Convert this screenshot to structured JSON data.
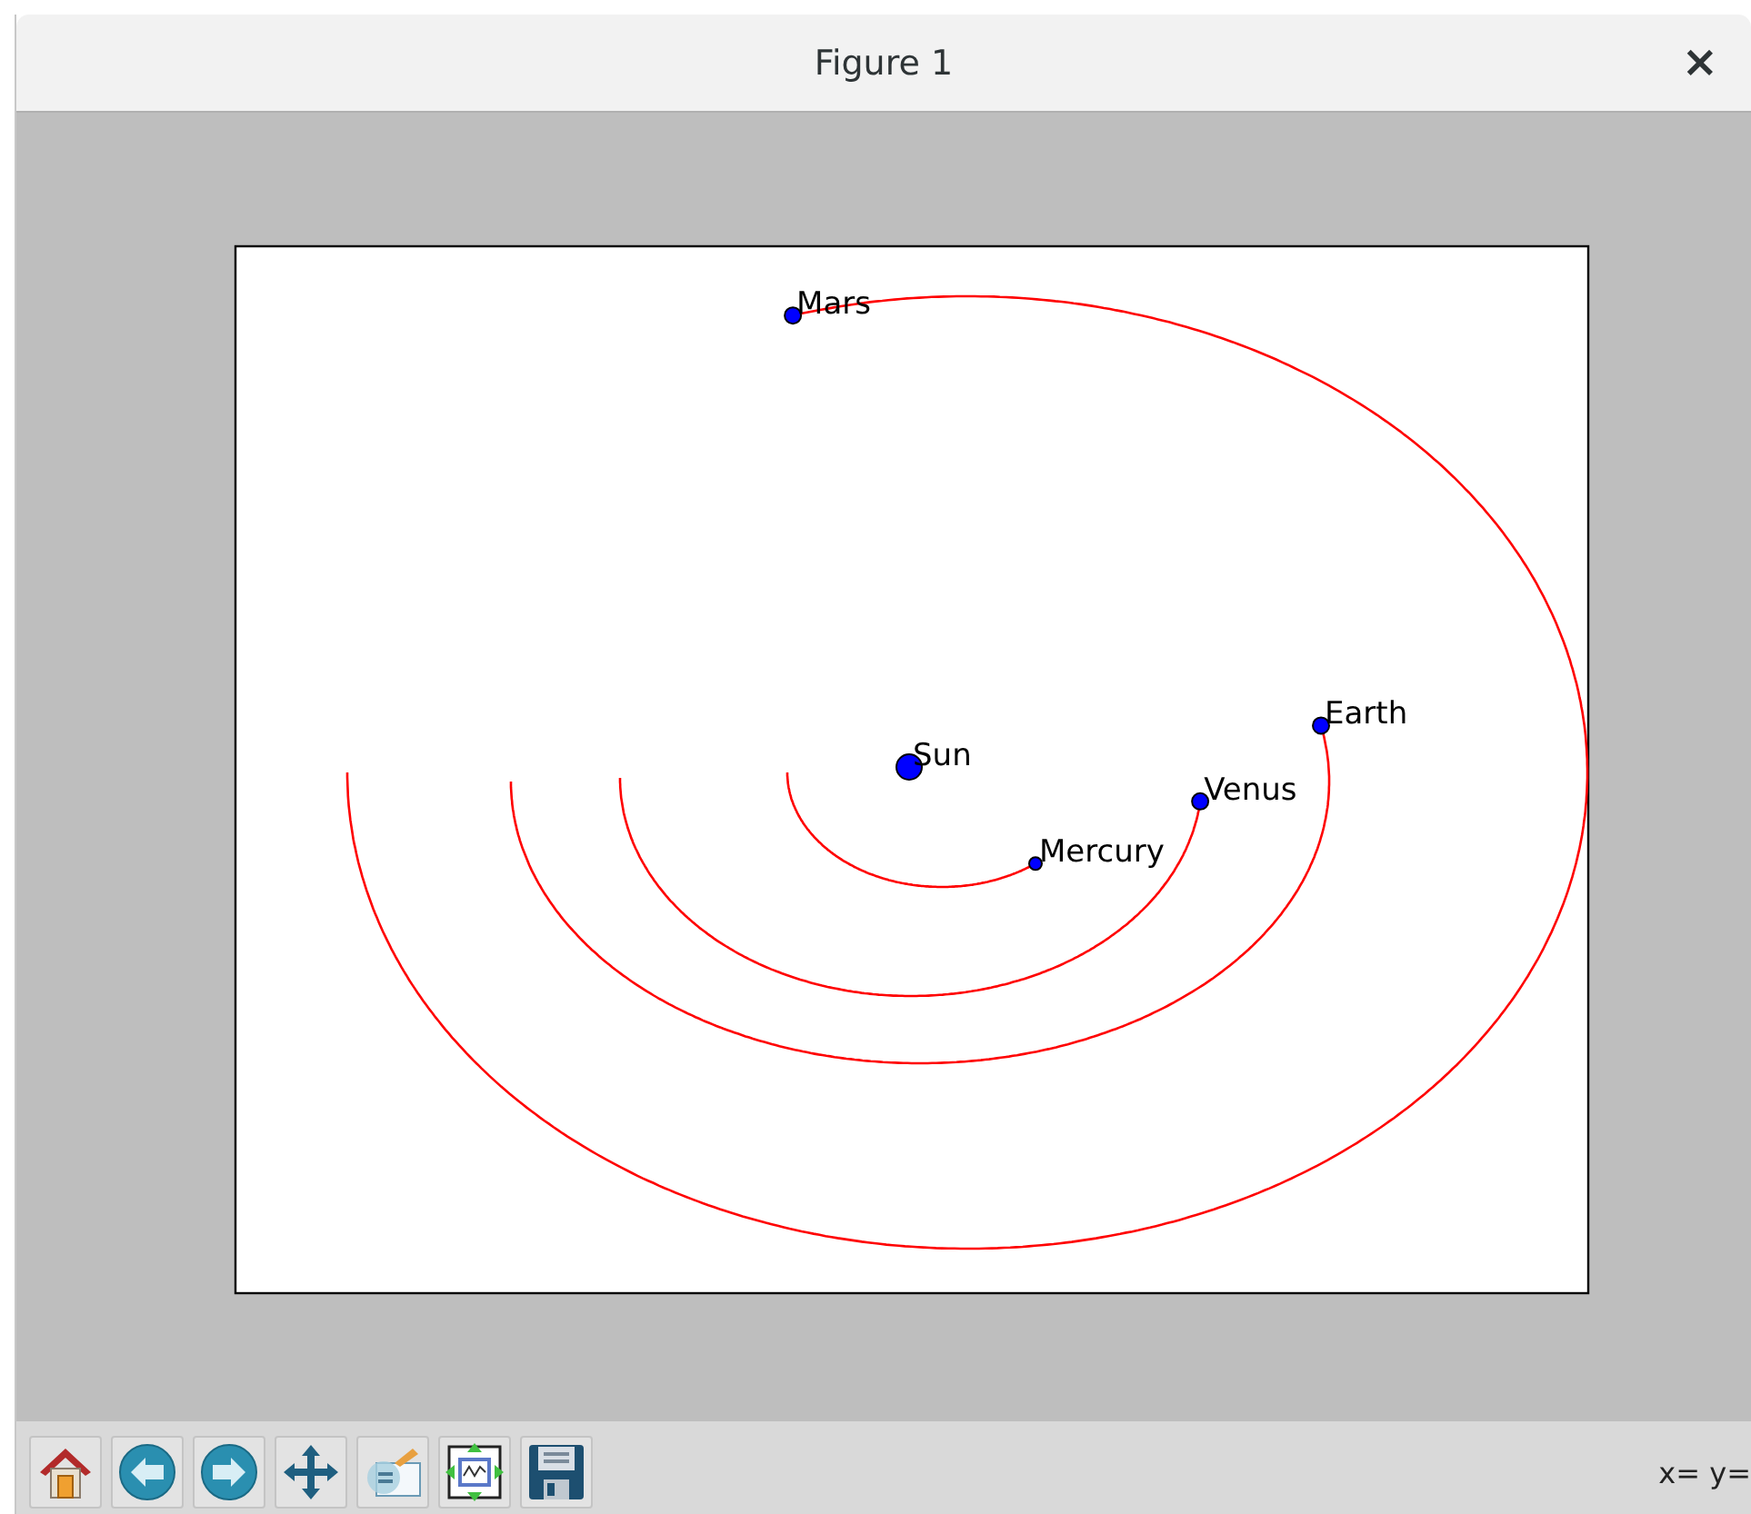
{
  "window": {
    "title": "Figure 1",
    "close": "×"
  },
  "plot": {
    "bodies": [
      {
        "name": "Mars",
        "kind": "planet"
      },
      {
        "name": "Earth",
        "kind": "planet"
      },
      {
        "name": "Sun",
        "kind": "star"
      },
      {
        "name": "Venus",
        "kind": "planet"
      },
      {
        "name": "Mercury",
        "kind": "planet"
      }
    ]
  },
  "toolbar": {
    "buttons": [
      {
        "kind": "home"
      },
      {
        "kind": "back"
      },
      {
        "kind": "forward"
      },
      {
        "kind": "pan"
      },
      {
        "kind": "zoom"
      },
      {
        "kind": "subplots"
      },
      {
        "kind": "save"
      }
    ],
    "coordinates": "x= y="
  }
}
